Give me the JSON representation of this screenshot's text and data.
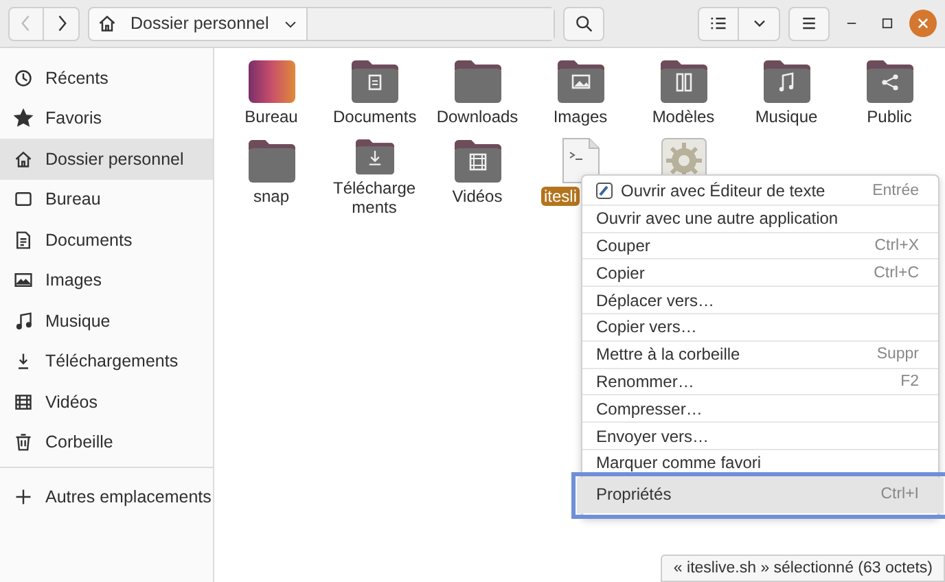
{
  "toolbar": {
    "back_disabled": true,
    "location": "Dossier personnel"
  },
  "sidebar": {
    "items": [
      {
        "label": "Récents",
        "kind": "recent",
        "selected": false
      },
      {
        "label": "Favoris",
        "kind": "star",
        "selected": false
      },
      {
        "label": "Dossier personnel",
        "kind": "home",
        "selected": true
      },
      {
        "label": "Bureau",
        "kind": "desktop",
        "selected": false
      },
      {
        "label": "Documents",
        "kind": "documents",
        "selected": false
      },
      {
        "label": "Images",
        "kind": "images",
        "selected": false
      },
      {
        "label": "Musique",
        "kind": "music",
        "selected": false
      },
      {
        "label": "Téléchargements",
        "kind": "downloads",
        "selected": false
      },
      {
        "label": "Vidéos",
        "kind": "videos",
        "selected": false
      },
      {
        "label": "Corbeille",
        "kind": "trash",
        "selected": false
      }
    ],
    "other": "Autres emplacements"
  },
  "files": [
    {
      "name": "Bureau",
      "kind": "desktop",
      "selected": false
    },
    {
      "name": "Documents",
      "kind": "documents",
      "selected": false
    },
    {
      "name": "Downloads",
      "kind": "folder",
      "selected": false
    },
    {
      "name": "Images",
      "kind": "images",
      "selected": false
    },
    {
      "name": "Modèles",
      "kind": "templates",
      "selected": false
    },
    {
      "name": "Musique",
      "kind": "music",
      "selected": false
    },
    {
      "name": "Public",
      "kind": "public",
      "selected": false
    },
    {
      "name": "snap",
      "kind": "folder",
      "selected": false
    },
    {
      "name": "Télécharge ments",
      "kind": "downloads",
      "selected": false
    },
    {
      "name": "Vidéos",
      "kind": "videos",
      "selected": false
    },
    {
      "name": "itesli",
      "kind": "script",
      "selected": true
    },
    {
      "kind": "executable",
      "selected": false
    }
  ],
  "context_menu": {
    "items": [
      {
        "label": "Ouvrir avec Éditeur de texte",
        "shortcut": "Entrée",
        "has_icon": true,
        "selected": false
      },
      {
        "label": "Ouvrir avec une autre application",
        "selected": false
      },
      {
        "label": "Couper",
        "shortcut": "Ctrl+X",
        "selected": false
      },
      {
        "label": "Copier",
        "shortcut": "Ctrl+C",
        "selected": false
      },
      {
        "label": "Déplacer vers…",
        "selected": false
      },
      {
        "label": "Copier vers…",
        "selected": false
      },
      {
        "label": "Mettre à la corbeille",
        "shortcut": "Suppr",
        "selected": false
      },
      {
        "label": "Renommer…",
        "shortcut": "F2",
        "selected": false
      },
      {
        "label": "Compresser…",
        "selected": false
      },
      {
        "label": "Envoyer vers…",
        "selected": false
      },
      {
        "label": "Marquer comme favori",
        "selected": false
      },
      {
        "label": "Propriétés",
        "shortcut": "Ctrl+I",
        "selected": true
      }
    ]
  },
  "status_bar": "« iteslive.sh » sélectionné  (63 octets)"
}
